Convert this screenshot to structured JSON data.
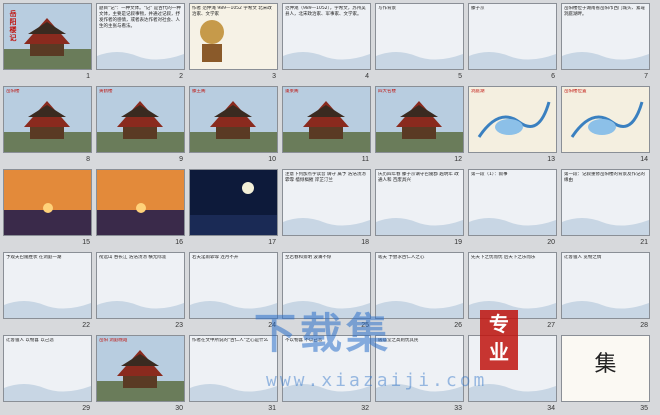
{
  "colors": {
    "accent_red": "#c0140e",
    "watermark_blue": "#2b70c8",
    "slide_border": "#8a8f96",
    "background": "#d7d9dc"
  },
  "slides": [
    {
      "num": "1",
      "kind": "title",
      "title": "岳阳楼记"
    },
    {
      "num": "2",
      "kind": "text",
      "text": "题目\"记\"：一种文体。\"记\" 是古代的一种文体，主要是记叙事物，并通过记叙，抒发作者的感情，或者表达作者对社会、人生的主张与看法。"
    },
    {
      "num": "3",
      "kind": "author",
      "text": "作者 范仲淹 989—1052 字希文 北宋政治家、文学家"
    },
    {
      "num": "4",
      "kind": "text",
      "text": "范仲淹（989—1052），字希文，苏州吴县人，北宋政治家、军事家、文学家。"
    },
    {
      "num": "5",
      "kind": "text",
      "text": "写作背景"
    },
    {
      "num": "6",
      "kind": "text",
      "text": "滕子京"
    },
    {
      "num": "7",
      "kind": "text",
      "text": "岳阳楼位于湖南省岳阳市西门城头、紧靠洞庭湖畔。"
    },
    {
      "num": "8",
      "kind": "photo",
      "text": "岳阳楼"
    },
    {
      "num": "9",
      "kind": "photo",
      "text": "黄鹤楼"
    },
    {
      "num": "10",
      "kind": "photo",
      "text": "滕王阁"
    },
    {
      "num": "11",
      "kind": "photo",
      "text": "蓬莱阁"
    },
    {
      "num": "12",
      "kind": "photo",
      "text": "四大名楼"
    },
    {
      "num": "13",
      "kind": "map",
      "text": "洞庭湖"
    },
    {
      "num": "14",
      "kind": "map",
      "text": "岳阳楼位置"
    },
    {
      "num": "15",
      "kind": "sunset",
      "text": ""
    },
    {
      "num": "16",
      "kind": "sunset",
      "text": ""
    },
    {
      "num": "17",
      "kind": "moon",
      "text": ""
    },
    {
      "num": "18",
      "kind": "text",
      "text": "注意下列加点字读音 谪守 属予 浩浩汤汤 霏霏 樯倾楫摧 岸芷汀兰"
    },
    {
      "num": "19",
      "kind": "text",
      "text": "庆历四年春 滕子京谪守巴陵郡 越明年 政通人和 百废具兴"
    },
    {
      "num": "20",
      "kind": "text",
      "text": "第一段（1）：叙事"
    },
    {
      "num": "21",
      "kind": "text",
      "text": "第一段：记叙重修岳阳楼的背景及作记的缘由"
    },
    {
      "num": "22",
      "kind": "text",
      "text": "予观夫巴陵胜状 在洞庭一湖"
    },
    {
      "num": "23",
      "kind": "text",
      "text": "衔远山 吞长江 浩浩汤汤 横无际涯"
    },
    {
      "num": "24",
      "kind": "text",
      "text": "若夫淫雨霏霏 连月不开"
    },
    {
      "num": "25",
      "kind": "text",
      "text": "至若春和景明 波澜不惊"
    },
    {
      "num": "26",
      "kind": "text",
      "text": "嗟夫 予尝求古仁人之心"
    },
    {
      "num": "27",
      "kind": "text",
      "text": "先天下之忧而忧 后天下之乐而乐"
    },
    {
      "num": "28",
      "kind": "text",
      "text": "迁客骚人 览物之情"
    },
    {
      "num": "29",
      "kind": "text",
      "text": "迁客骚人 以物喜 以己悲"
    },
    {
      "num": "30",
      "kind": "photo",
      "text": "岳阳 洞庭晚霞"
    },
    {
      "num": "31",
      "kind": "text",
      "text": "作者在文中所说的\"古仁人\"之心是什么"
    },
    {
      "num": "32",
      "kind": "text",
      "text": "不以物喜 不以己悲"
    },
    {
      "num": "33",
      "kind": "text",
      "text": "居庙堂之高则忧其民"
    },
    {
      "num": "34",
      "kind": "text",
      "text": ""
    },
    {
      "num": "35",
      "kind": "calligraphy",
      "text": "集"
    }
  ],
  "watermark": {
    "main": "下载集",
    "url": "www.xiazaiji.com",
    "badge_top": "专",
    "badge_bottom": "业"
  }
}
